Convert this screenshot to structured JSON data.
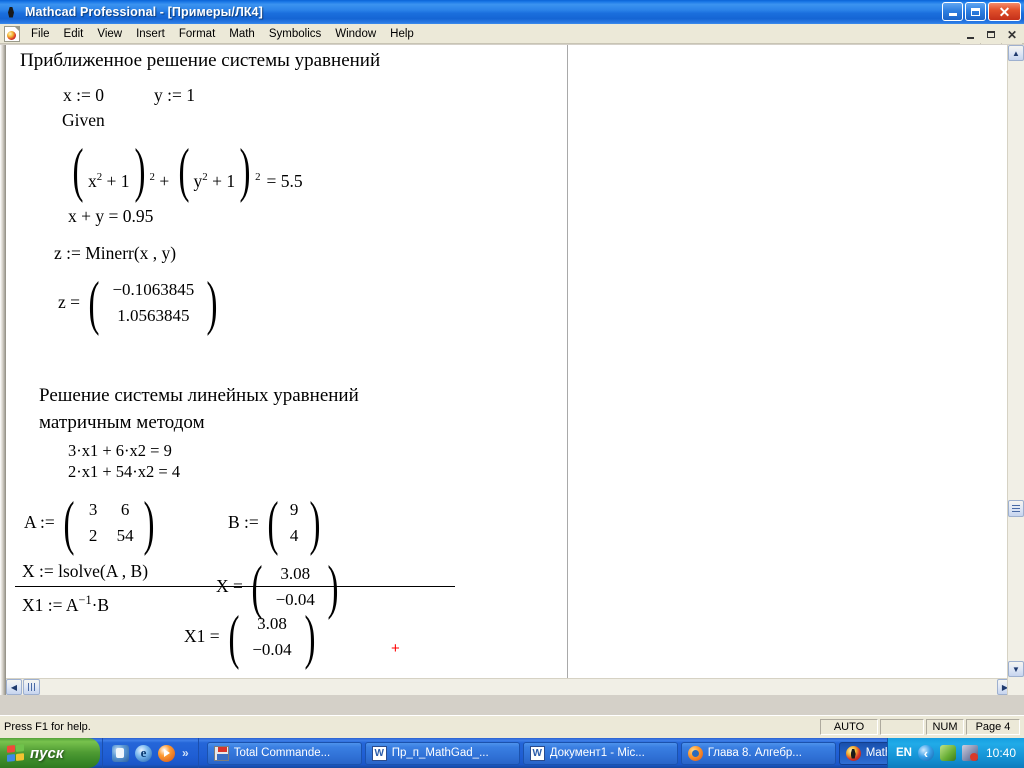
{
  "window": {
    "app_title": "Mathcad Professional - [Примеры/ЛК4]",
    "icon": "mathcad-logo-icon",
    "buttons": {
      "minimize": "minimize-icon",
      "maximize": "maximize-icon",
      "close": "close-icon"
    },
    "mdi_buttons": {
      "minimize": "mdi-minimize-icon",
      "restore": "mdi-restore-icon",
      "close": "mdi-close-icon"
    }
  },
  "menu": {
    "items": [
      {
        "label": "File"
      },
      {
        "label": "Edit"
      },
      {
        "label": "View"
      },
      {
        "label": "Insert"
      },
      {
        "label": "Format"
      },
      {
        "label": "Math"
      },
      {
        "label": "Symbolics"
      },
      {
        "label": "Window"
      },
      {
        "label": "Help"
      }
    ]
  },
  "worksheet": {
    "section1": {
      "heading": "Приближенное решение системы уравнений",
      "assign_x": "x := 0",
      "assign_y": "y := 1",
      "given": "Given",
      "eq1_left": "x",
      "eq1_exp_inner1": "2",
      "eq1_plus1": " + 1",
      "eq1_exp_outer1": "2",
      "eq1_mid": " + ",
      "eq1_var2": "y",
      "eq1_exp_inner2": "2",
      "eq1_plus2": " + 1",
      "eq1_exp_outer2": "2",
      "eq1_rhs": "= 5.5",
      "eq2": "x + y  =  0.95",
      "minerr": "z := Minerr(x , y)",
      "z_result_label": "z  =",
      "z_result": [
        "−0.1063845",
        "1.0563845"
      ]
    },
    "section2": {
      "heading_line1": "Решение системы линейных уравнений",
      "heading_line2": "матричным методом",
      "lin_eq1": "3·x1 + 6·x2  =  9",
      "lin_eq2": "2·x1 + 54·x2  =  4",
      "A_label": "A  :=",
      "A_matrix": [
        [
          "3",
          "6"
        ],
        [
          "2",
          "54"
        ]
      ],
      "B_label": "B  :=",
      "B_matrix": [
        [
          "9"
        ],
        [
          "4"
        ]
      ],
      "lsolve": "X := lsolve(A , B)",
      "X_label": "X  =",
      "X_matrix": [
        [
          "3.08"
        ],
        [
          "−0.04"
        ]
      ],
      "X1_def_prefix": "X1  :=  A",
      "X1_def_exp": "−1",
      "X1_def_suffix": "·B",
      "X1_label": "X1  =",
      "X1_matrix": [
        [
          "3.08"
        ],
        [
          "−0.04"
        ]
      ],
      "cursor_marker": "+"
    }
  },
  "scrollbars": {
    "v_up": "scroll-up-arrow",
    "v_down": "scroll-down-arrow",
    "v_thumb": "vertical-scroll-thumb",
    "h_left": "scroll-left-arrow",
    "h_right": "scroll-right-arrow",
    "h_thumb": "horizontal-scroll-thumb"
  },
  "statusbar": {
    "help": "Press F1 for help.",
    "auto": "AUTO",
    "blank": "",
    "num": "NUM",
    "page": "Page 4"
  },
  "taskbar": {
    "start": "пуск",
    "quicklaunch": [
      {
        "icon": "mathcad-quicklaunch-icon"
      },
      {
        "icon": "internet-explorer-icon"
      },
      {
        "icon": "media-player-icon"
      },
      {
        "icon": "chevron-right-icon",
        "label": "»"
      }
    ],
    "tasks": [
      {
        "label": "Total Commande...",
        "icon": "floppy-icon",
        "active": false
      },
      {
        "label": "Пр_п_MathGad_...",
        "icon": "word-icon",
        "active": false
      },
      {
        "label": "Документ1 - Мiс...",
        "icon": "word-icon",
        "active": false
      },
      {
        "label": "Глава 8. Алгебр...",
        "icon": "firefox-icon",
        "active": false
      },
      {
        "label": "Mathcad Professi...",
        "icon": "mathcad-icon",
        "active": true
      }
    ],
    "tray": {
      "language": "EN",
      "icons": [
        "volume-icon",
        "shield-icon",
        "network-icon"
      ],
      "clock": "10:40"
    }
  },
  "colors": {
    "title_blue": "#1a6fdd",
    "menu_bg": "#ece9d8",
    "canvas": "#ffffff",
    "cursor_red": "#ff0000",
    "taskbar_blue": "#2566d8",
    "start_green": "#4e9b33"
  }
}
